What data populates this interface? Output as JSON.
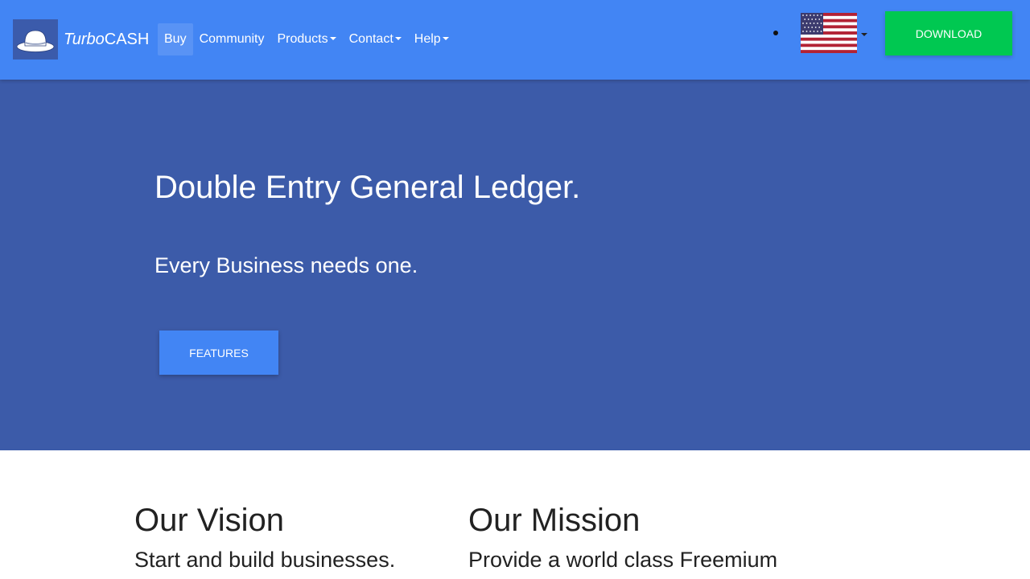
{
  "brand": {
    "name_italic": "Turbo",
    "name_rest": "CASH"
  },
  "nav": {
    "items": [
      {
        "label": "Buy",
        "active": true,
        "dropdown": false
      },
      {
        "label": "Community",
        "active": false,
        "dropdown": false
      },
      {
        "label": "Products",
        "active": false,
        "dropdown": true
      },
      {
        "label": "Contact",
        "active": false,
        "dropdown": true
      },
      {
        "label": "Help",
        "active": false,
        "dropdown": true
      }
    ],
    "language_icon": "us-flag-icon",
    "download_label": "Download"
  },
  "hero": {
    "title": "Double Entry General Ledger.",
    "subtitle": "Every Business needs one.",
    "button_label": "Features"
  },
  "sections": {
    "vision": {
      "heading": "Our Vision",
      "text": "Start and build businesses."
    },
    "mission": {
      "heading": "Our Mission",
      "text": "Provide a world class Freemium"
    }
  },
  "colors": {
    "navbar": "#4285f4",
    "hero": "#3c5ba9",
    "download": "#00c851",
    "primary_button": "#4285f4"
  }
}
